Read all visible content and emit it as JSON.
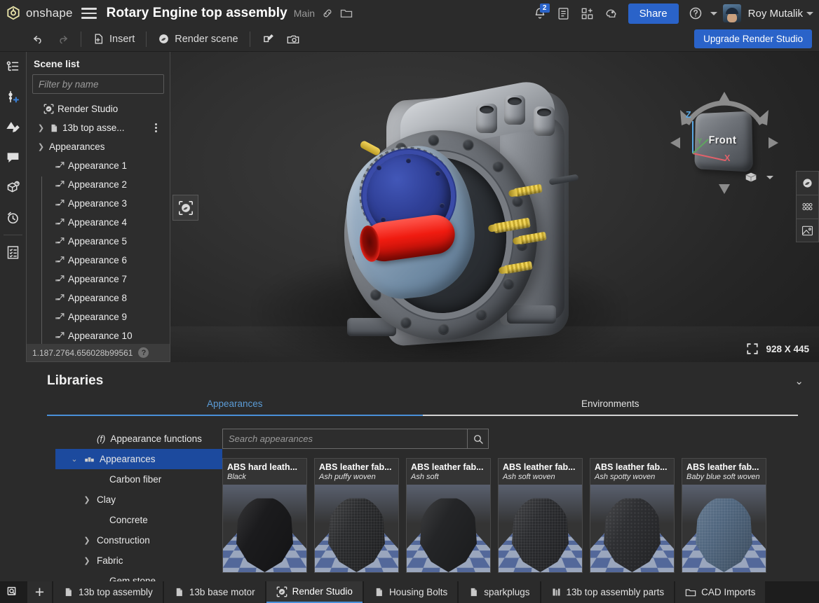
{
  "topbar": {
    "brand": "onshape",
    "menu_icon": "hamburger-icon",
    "document_title": "Rotary Engine top assembly",
    "branch": "Main",
    "link_icon": "link-icon",
    "folder_icon": "folder-icon",
    "notification_count": "2",
    "share_label": "Share",
    "user_name": "Roy Mutalik"
  },
  "toolbar": {
    "undo_label": "undo",
    "redo_label": "redo",
    "insert_label": "Insert",
    "render_scene_label": "Render scene",
    "appearance_tool_label": "edit-appearance",
    "camera_tool_label": "camera-tool",
    "upgrade_label": "Upgrade Render Studio"
  },
  "rail": {
    "items": [
      {
        "name": "scene-tree",
        "label": "Scene list"
      },
      {
        "name": "add-light",
        "label": "Add light"
      },
      {
        "name": "appearance-brush",
        "label": "Appearances"
      },
      {
        "name": "comments",
        "label": "Comments"
      },
      {
        "name": "part-info",
        "label": "Part info"
      },
      {
        "name": "render-history",
        "label": "Render history"
      },
      {
        "name": "bill-of-materials",
        "label": "Bill of materials"
      }
    ]
  },
  "scene_panel": {
    "title": "Scene list",
    "filter_placeholder": "Filter by name",
    "root_label": "Render Studio",
    "assembly_label": "13b top asse...",
    "group_label": "Appearances",
    "appearances": [
      "Appearance 1",
      "Appearance 2",
      "Appearance 3",
      "Appearance 4",
      "Appearance 5",
      "Appearance 6",
      "Appearance 7",
      "Appearance 8",
      "Appearance 9",
      "Appearance 10"
    ],
    "version": "1.187.2764.656028b99561",
    "help_label": "?"
  },
  "viewport": {
    "cube_label": "Front",
    "axis_z": "Z",
    "axis_y": "Y",
    "axis_x": "X",
    "resolution": "928 X 445",
    "render_badge": "render-studio-badge",
    "view_tools": [
      {
        "name": "render-view-tool"
      },
      {
        "name": "render-quality-tool"
      },
      {
        "name": "background-image-tool"
      }
    ]
  },
  "libraries": {
    "title": "Libraries",
    "collapse_icon": "chevron-down-icon",
    "tabs": [
      {
        "label": "Appearances",
        "active": true
      },
      {
        "label": "Environments",
        "active": false
      }
    ],
    "search_placeholder": "Search appearances",
    "tree": [
      {
        "label": "Appearance functions",
        "icon": "function-icon",
        "expandable": false,
        "selected": false,
        "indent": 1
      },
      {
        "label": "Appearances",
        "icon": "appearances-icon",
        "expandable": true,
        "expanded": true,
        "selected": true,
        "indent": 0
      },
      {
        "label": "Carbon fiber",
        "icon": "",
        "expandable": false,
        "selected": false,
        "indent": 2
      },
      {
        "label": "Clay",
        "icon": "",
        "expandable": true,
        "expanded": false,
        "selected": false,
        "indent": 1
      },
      {
        "label": "Concrete",
        "icon": "",
        "expandable": false,
        "selected": false,
        "indent": 2
      },
      {
        "label": "Construction",
        "icon": "",
        "expandable": true,
        "expanded": false,
        "selected": false,
        "indent": 1
      },
      {
        "label": "Fabric",
        "icon": "",
        "expandable": true,
        "expanded": false,
        "selected": false,
        "indent": 1
      },
      {
        "label": "Gem stone",
        "icon": "",
        "expandable": false,
        "selected": false,
        "indent": 2
      }
    ],
    "cards": [
      {
        "title": "ABS hard leath...",
        "subtitle": "Black",
        "cloth_color": "#1b1b1d",
        "weave": "none"
      },
      {
        "title": "ABS leather fab...",
        "subtitle": "Ash puffy woven",
        "cloth_color": "#2a2b2d",
        "weave": "grid"
      },
      {
        "title": "ABS leather fab...",
        "subtitle": "Ash soft",
        "cloth_color": "#242527",
        "weave": "none"
      },
      {
        "title": "ABS leather fab...",
        "subtitle": "Ash soft woven",
        "cloth_color": "#2b2c2f",
        "weave": "grid"
      },
      {
        "title": "ABS leather fab...",
        "subtitle": "Ash spotty woven",
        "cloth_color": "#2e2f32",
        "weave": "dots"
      },
      {
        "title": "ABS leather fab...",
        "subtitle": "Baby blue soft woven",
        "cloth_color": "#51677f",
        "weave": "grid"
      }
    ]
  },
  "tabbar": {
    "search_icon": "search-document-icon",
    "add_label": "+",
    "tabs": [
      {
        "label": "13b top assembly",
        "icon": "assembly-icon",
        "active": false
      },
      {
        "label": "13b base motor",
        "icon": "assembly-icon",
        "active": false
      },
      {
        "label": "Render Studio",
        "icon": "render-studio-icon",
        "active": true
      },
      {
        "label": "Housing Bolts",
        "icon": "assembly-icon",
        "active": false
      },
      {
        "label": "sparkplugs",
        "icon": "assembly-icon",
        "active": false
      },
      {
        "label": "13b top assembly parts",
        "icon": "parts-icon",
        "active": false
      },
      {
        "label": "CAD Imports",
        "icon": "folder-icon",
        "active": false
      }
    ]
  },
  "colors": {
    "accent_blue": "#2a63c9",
    "tab_blue": "#4a90d9",
    "panel_bg": "#2b2b2b",
    "viewport_bg": "#303030"
  }
}
